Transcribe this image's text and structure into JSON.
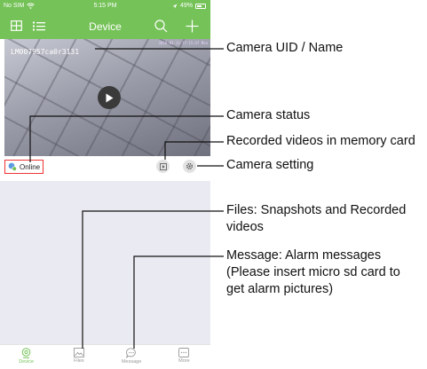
{
  "status_bar": {
    "carrier": "No SIM",
    "time": "5:15 PM",
    "battery": "49%"
  },
  "nav_bar": {
    "title": "Device",
    "left_icons": [
      "grid-icon",
      "list-icon"
    ],
    "right_icons": [
      "search-icon",
      "plus-icon"
    ]
  },
  "camera": {
    "name": "LM007957ca0r3131",
    "timestamp": "2018-03-13 17:15:47 Mon",
    "status": "Online"
  },
  "tabs": [
    {
      "label": "Device",
      "icon": "camera-icon",
      "active": true
    },
    {
      "label": "Files",
      "icon": "image-icon",
      "active": false
    },
    {
      "label": "Message",
      "icon": "chat-icon",
      "active": false
    },
    {
      "label": "More",
      "icon": "more-icon",
      "active": false
    }
  ],
  "annotations": {
    "uid": "Camera UID / Name",
    "status": "Camera status",
    "recorded_line1": "Recorded videos in memory card",
    "setting": "Camera setting",
    "files_line1": "Files: Snapshots and Recorded",
    "files_line2": "videos",
    "message_line1": "Message: Alarm messages",
    "message_line2": "(Please insert micro sd card to",
    "message_line3": "get alarm pictures)"
  },
  "colors": {
    "brand_green": "#75c258",
    "highlight_red": "#e33333",
    "background_gray": "#eaeaf2"
  }
}
